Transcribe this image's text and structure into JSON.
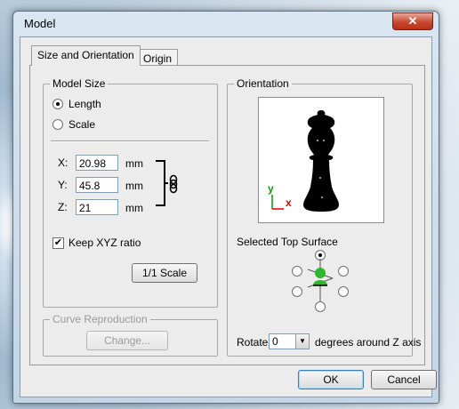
{
  "window": {
    "title": "Model",
    "close_glyph": "✕"
  },
  "tabs": [
    {
      "label": "Size and Orientation",
      "active": true
    },
    {
      "label": "Origin",
      "active": false
    }
  ],
  "model_size": {
    "legend": "Model Size",
    "options": [
      {
        "label": "Length",
        "selected": true
      },
      {
        "label": "Scale",
        "selected": false
      }
    ],
    "fields": [
      {
        "axis": "X:",
        "value": "20.98",
        "unit": "mm"
      },
      {
        "axis": "Y:",
        "value": "45.8",
        "unit": "mm"
      },
      {
        "axis": "Z:",
        "value": "21",
        "unit": "mm"
      }
    ],
    "link_icon": "chain-link-icon",
    "keep_ratio": {
      "label": "Keep XYZ ratio",
      "checked": true,
      "mark": "✔"
    },
    "scale_button": "1/1 Scale"
  },
  "curve": {
    "legend": "Curve Reproduction",
    "button": "Change..."
  },
  "orientation": {
    "legend": "Orientation",
    "axis_y": "y",
    "axis_x": "x",
    "axis_y_color": "#00a000",
    "axis_x_color": "#e00000",
    "top_surface_label": "Selected Top Surface",
    "rotate_label": "Rotate",
    "rotate_value": "0",
    "rotate_suffix": "degrees around Z axis",
    "dropdown_glyph": "▼"
  },
  "footer": {
    "ok": "OK",
    "cancel": "Cancel"
  }
}
